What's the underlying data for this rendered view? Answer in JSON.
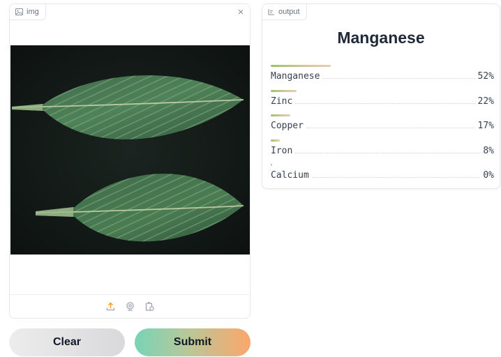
{
  "input_panel": {
    "label": "img",
    "label_icon": "image-icon",
    "close_label": "×",
    "toolbar_icons": [
      "upload-icon",
      "webcam-icon",
      "clipboard-icon"
    ]
  },
  "buttons": {
    "clear_label": "Clear",
    "submit_label": "Submit"
  },
  "output_panel": {
    "label": "output",
    "label_icon": "label-icon",
    "title": "Manganese",
    "results": [
      {
        "label": "Manganese",
        "percent": "52%",
        "fraction": 0.52
      },
      {
        "label": "Zinc",
        "percent": "22%",
        "fraction": 0.22
      },
      {
        "label": "Copper",
        "percent": "17%",
        "fraction": 0.17
      },
      {
        "label": "Iron",
        "percent": "8%",
        "fraction": 0.08
      },
      {
        "label": "Calcium",
        "percent": "0%",
        "fraction": 0.0
      }
    ]
  },
  "colors": {
    "bar_green": "#9cc26a",
    "bar_tan": "#e3cfae",
    "submit_start": "#78d4b6",
    "submit_end": "#fca66a",
    "clear": "#e3e3e5"
  }
}
